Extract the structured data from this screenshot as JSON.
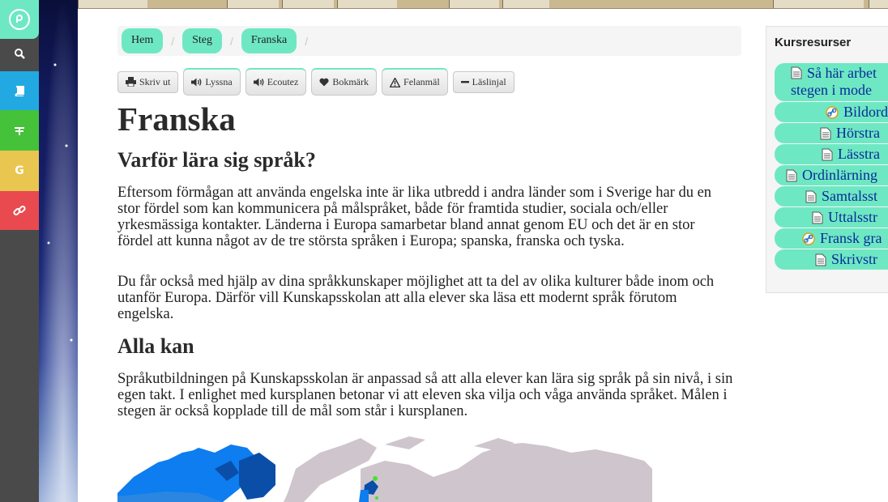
{
  "nav": {
    "logo": "",
    "g_label": "G"
  },
  "breadcrumb": [
    "Hem",
    "Steg",
    "Franska"
  ],
  "tools": {
    "print": "Skriv ut",
    "listen": "Lyssna",
    "ecoutez": "Ecoutez",
    "bookmark": "Bokmärk",
    "report": "Felanmäl",
    "reading_line": "Läslinjal"
  },
  "content": {
    "title": "Franska",
    "h2_why": "Varför lära sig språk?",
    "p1": "Eftersom förmågan att använda engelska inte är lika utbredd i andra länder som i Sverige har du en stor fördel som kan kommunicera på målspråket, både för framtida studier, sociala och/eller yrkesmässiga kontakter. Länderna i Europa samarbetar bland annat genom EU och det är en stor fördel att kunna något av de tre största språken i Europa; spanska, franska och tyska.",
    "p2": "Du får också med hjälp av dina språkkunskaper möjlighet att ta del av olika kulturer både inom och utanför Europa. Därför vill Kunskapsskolan att alla elever ska läsa ett modernt språk förutom engelska.",
    "h2_all": "Alla kan",
    "p3": "Språkutbildningen på Kunskapsskolan är anpassad så att alla elever kan lära sig språk på sin nivå, i sin egen takt. I enlighet med kursplanen betonar vi att eleven ska vilja och våga använda språket. Målen i stegen är också kopplade till de mål som står i kursplanen."
  },
  "sidebar": {
    "title": "Kursresurser",
    "items": [
      {
        "line1": "Så här arbet",
        "line2": "stegen i mode",
        "icon": "document-icon"
      },
      {
        "label": "Bildord",
        "icon": "link-icon"
      },
      {
        "label": "Hörstra",
        "icon": "document-icon"
      },
      {
        "label": "Lässtra",
        "icon": "document-icon"
      },
      {
        "label": "Ordinlärning",
        "icon": "document-icon"
      },
      {
        "label": "Samtalsst",
        "icon": "document-icon"
      },
      {
        "label": "Uttalsstr",
        "icon": "document-icon"
      },
      {
        "label": "Fransk gra",
        "icon": "link-icon"
      },
      {
        "label": "Skrivstr",
        "icon": "document-icon"
      }
    ]
  },
  "colors": {
    "accent": "#6ee8c3",
    "nav_blue": "#23a9e1",
    "nav_green": "#45c23a",
    "nav_yellow": "#e8c650",
    "nav_red": "#e84a50",
    "link": "#0b2a99"
  }
}
